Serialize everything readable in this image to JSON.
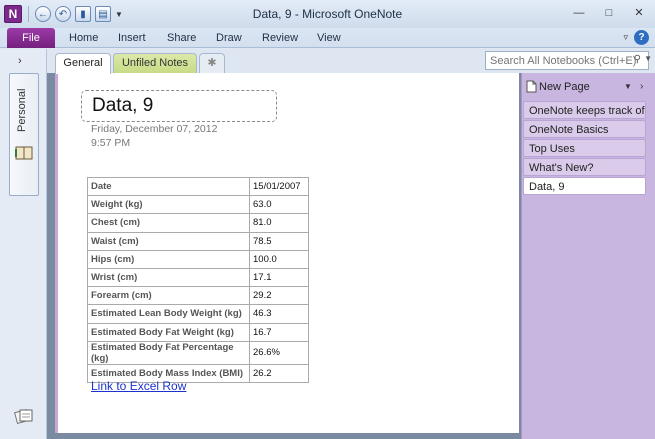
{
  "window": {
    "title": "Data, 9  -  Microsoft OneNote"
  },
  "quick_access": {
    "logo": "N"
  },
  "ribbon": {
    "file": "File",
    "tabs": [
      "Home",
      "Insert",
      "Share",
      "Draw",
      "Review",
      "View"
    ]
  },
  "notebook": {
    "name": "Personal"
  },
  "sections": {
    "active": "General",
    "other": "Unfiled Notes"
  },
  "search": {
    "placeholder": "Search All Notebooks (Ctrl+E)"
  },
  "page": {
    "title": "Data, 9",
    "date": "Friday, December  07, 2012",
    "time": "9:57 PM",
    "link": "Link to Excel Row"
  },
  "table": {
    "rows": [
      {
        "label": "Date",
        "value": "15/01/2007"
      },
      {
        "label": "Weight (kg)",
        "value": "63.0"
      },
      {
        "label": "Chest (cm)",
        "value": "81.0"
      },
      {
        "label": "Waist (cm)",
        "value": "78.5"
      },
      {
        "label": "Hips (cm)",
        "value": "100.0"
      },
      {
        "label": "Wrist (cm)",
        "value": "17.1"
      },
      {
        "label": "Forearm (cm)",
        "value": "29.2"
      },
      {
        "label": "Estimated Lean Body Weight (kg)",
        "value": "46.3"
      },
      {
        "label": "Estimated Body Fat Weight (kg)",
        "value": "16.7"
      },
      {
        "label": "Estimated Body Fat Percentage  (kg)",
        "value": "26.6%"
      },
      {
        "label": "Estimated Body Mass Index  (BMI)",
        "value": "26.2"
      }
    ]
  },
  "page_list": {
    "new_page": "New Page",
    "items": [
      "OneNote keeps track of",
      "OneNote Basics",
      "Top Uses",
      "What's New?",
      "Data, 9"
    ],
    "selected_index": 4
  },
  "colors": {
    "file_tab": "#75207f",
    "page_pane": "#c9b6e0",
    "link": "#1b33cc"
  }
}
